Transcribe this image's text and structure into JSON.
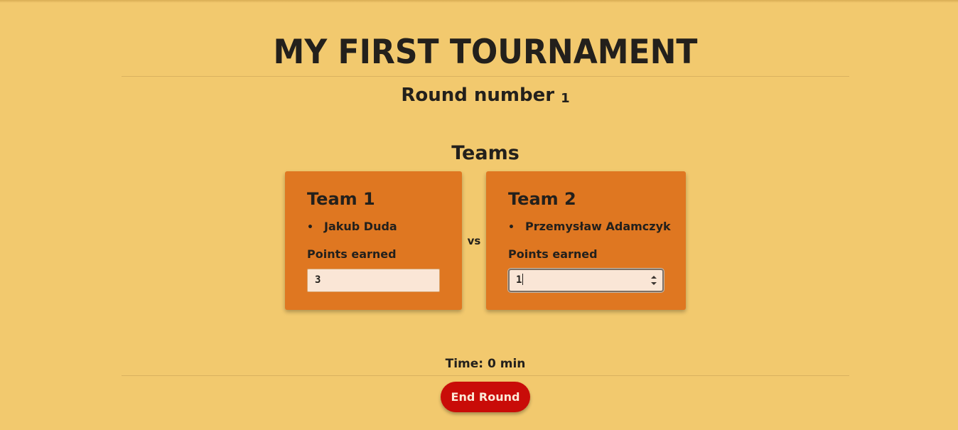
{
  "tournament": {
    "title": "MY FIRST TOURNAMENT"
  },
  "round": {
    "label": "Round number",
    "number": "1"
  },
  "teams_heading": "Teams",
  "versus_label": "vs",
  "teams": [
    {
      "name": "Team 1",
      "players": [
        "Jakub Duda"
      ],
      "points_label": "Points earned",
      "points_value": "3"
    },
    {
      "name": "Team 2",
      "players": [
        "Przemysław Adamczyk"
      ],
      "points_label": "Points earned",
      "points_value": "1"
    }
  ],
  "time": {
    "label": "Time: 0 min"
  },
  "end_button": {
    "label": "End Round"
  },
  "colors": {
    "background": "#f2c96e",
    "card": "#df7721",
    "input": "#fae6d6",
    "end_button": "#c90c08",
    "text": "#23201c"
  }
}
